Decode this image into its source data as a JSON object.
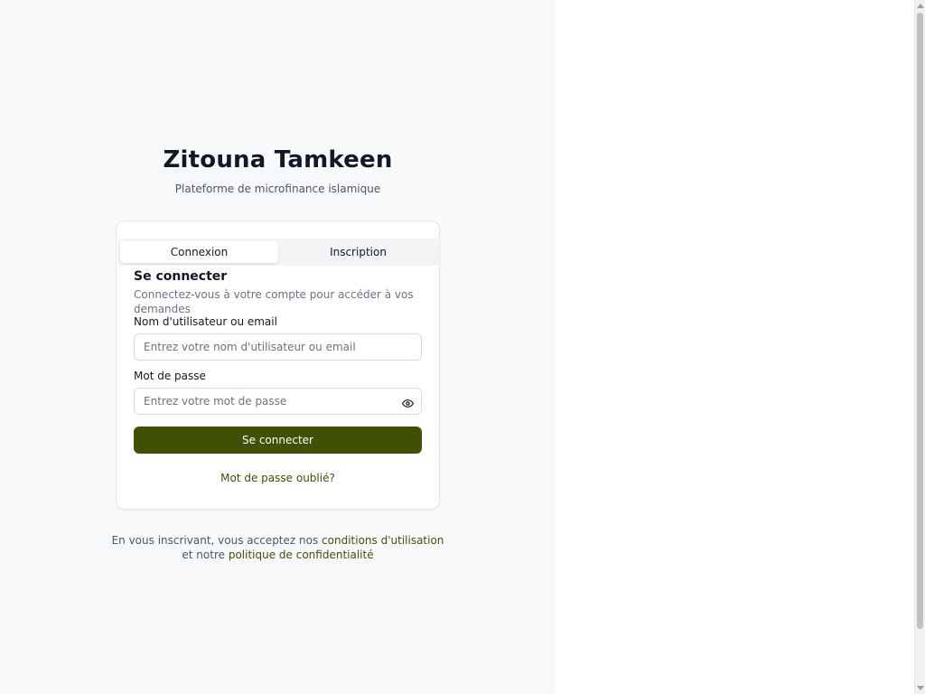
{
  "app": {
    "title": "Zitouna Tamkeen",
    "subtitle": "Plateforme de microfinance islamique"
  },
  "tabs": [
    {
      "label": "Connexion",
      "active": true
    },
    {
      "label": "Inscription",
      "active": false
    }
  ],
  "login": {
    "title": "Se connecter",
    "description": "Connectez-vous à votre compte pour accéder à vos demandes",
    "username": {
      "label": "Nom d'utilisateur ou email",
      "placeholder": "Entrez votre nom d'utilisateur ou email",
      "value": ""
    },
    "password": {
      "label": "Mot de passe",
      "placeholder": "Entrez votre mot de passe",
      "value": "",
      "toggle_icon": "eye-icon"
    },
    "submit_label": "Se connecter",
    "forgot_label": "Mot de passe oublié?"
  },
  "terms": {
    "prefix": "En vous inscrivant, vous acceptez nos",
    "terms_link": "conditions d'utilisation",
    "middle": "et notre",
    "privacy_link": "politique de confidentialité"
  },
  "colors": {
    "accent": "#3f5104",
    "left_background": "#f8f9fb",
    "title_text": "#111827",
    "muted_text": "#6b7280"
  }
}
